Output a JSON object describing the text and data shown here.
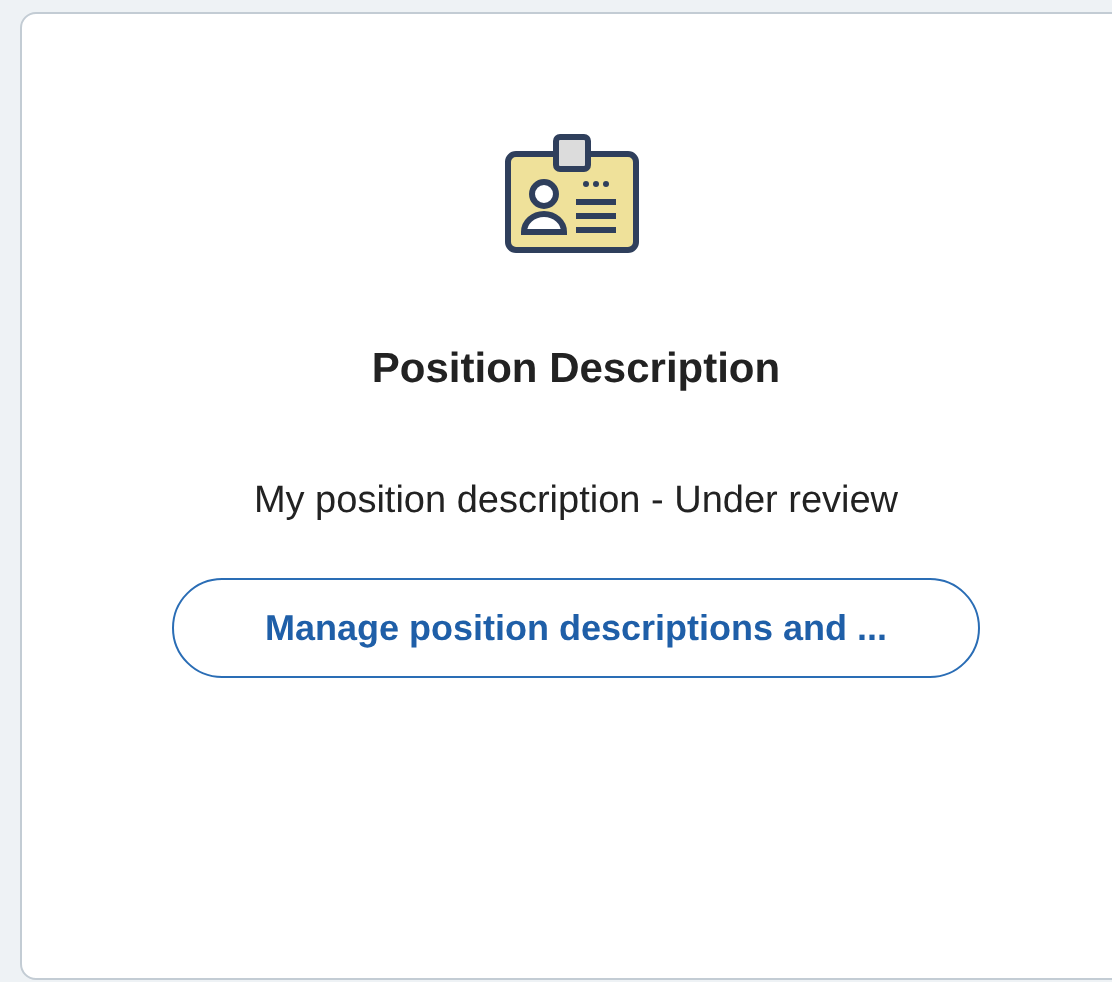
{
  "card": {
    "title": "Position Description",
    "description": "My position description - Under review",
    "button": "Manage position descriptions and ..."
  }
}
